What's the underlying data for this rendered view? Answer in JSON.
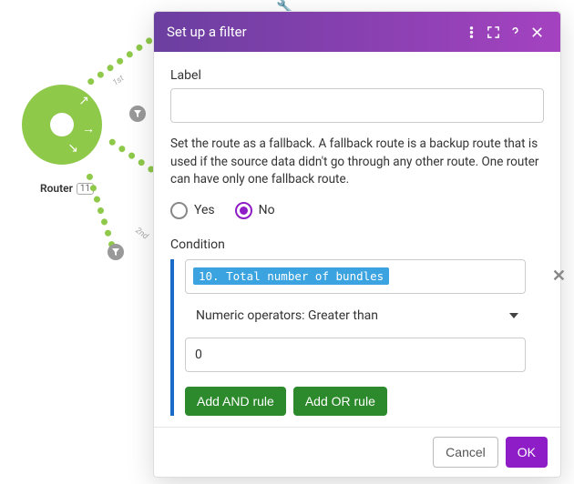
{
  "canvas": {
    "router_label": "Router",
    "router_badge": "11",
    "ordinals": {
      "first": "1st",
      "second": "2nd"
    }
  },
  "dialog": {
    "title": "Set up a filter",
    "label_field_label": "Label",
    "label_value": "",
    "fallback_description": "Set the route as a fallback. A fallback route is a backup route that is used if the source data didn't go through any other route. One router can have only one fallback route.",
    "fallback_options": {
      "yes": "Yes",
      "no": "No"
    },
    "fallback_selected": "no",
    "condition_label": "Condition",
    "condition": {
      "field_pill": "10. Total number of bundles",
      "operator": "Numeric operators: Greater than",
      "value": "0"
    },
    "buttons": {
      "add_and": "Add AND rule",
      "add_or": "Add OR rule",
      "cancel": "Cancel",
      "ok": "OK"
    }
  }
}
